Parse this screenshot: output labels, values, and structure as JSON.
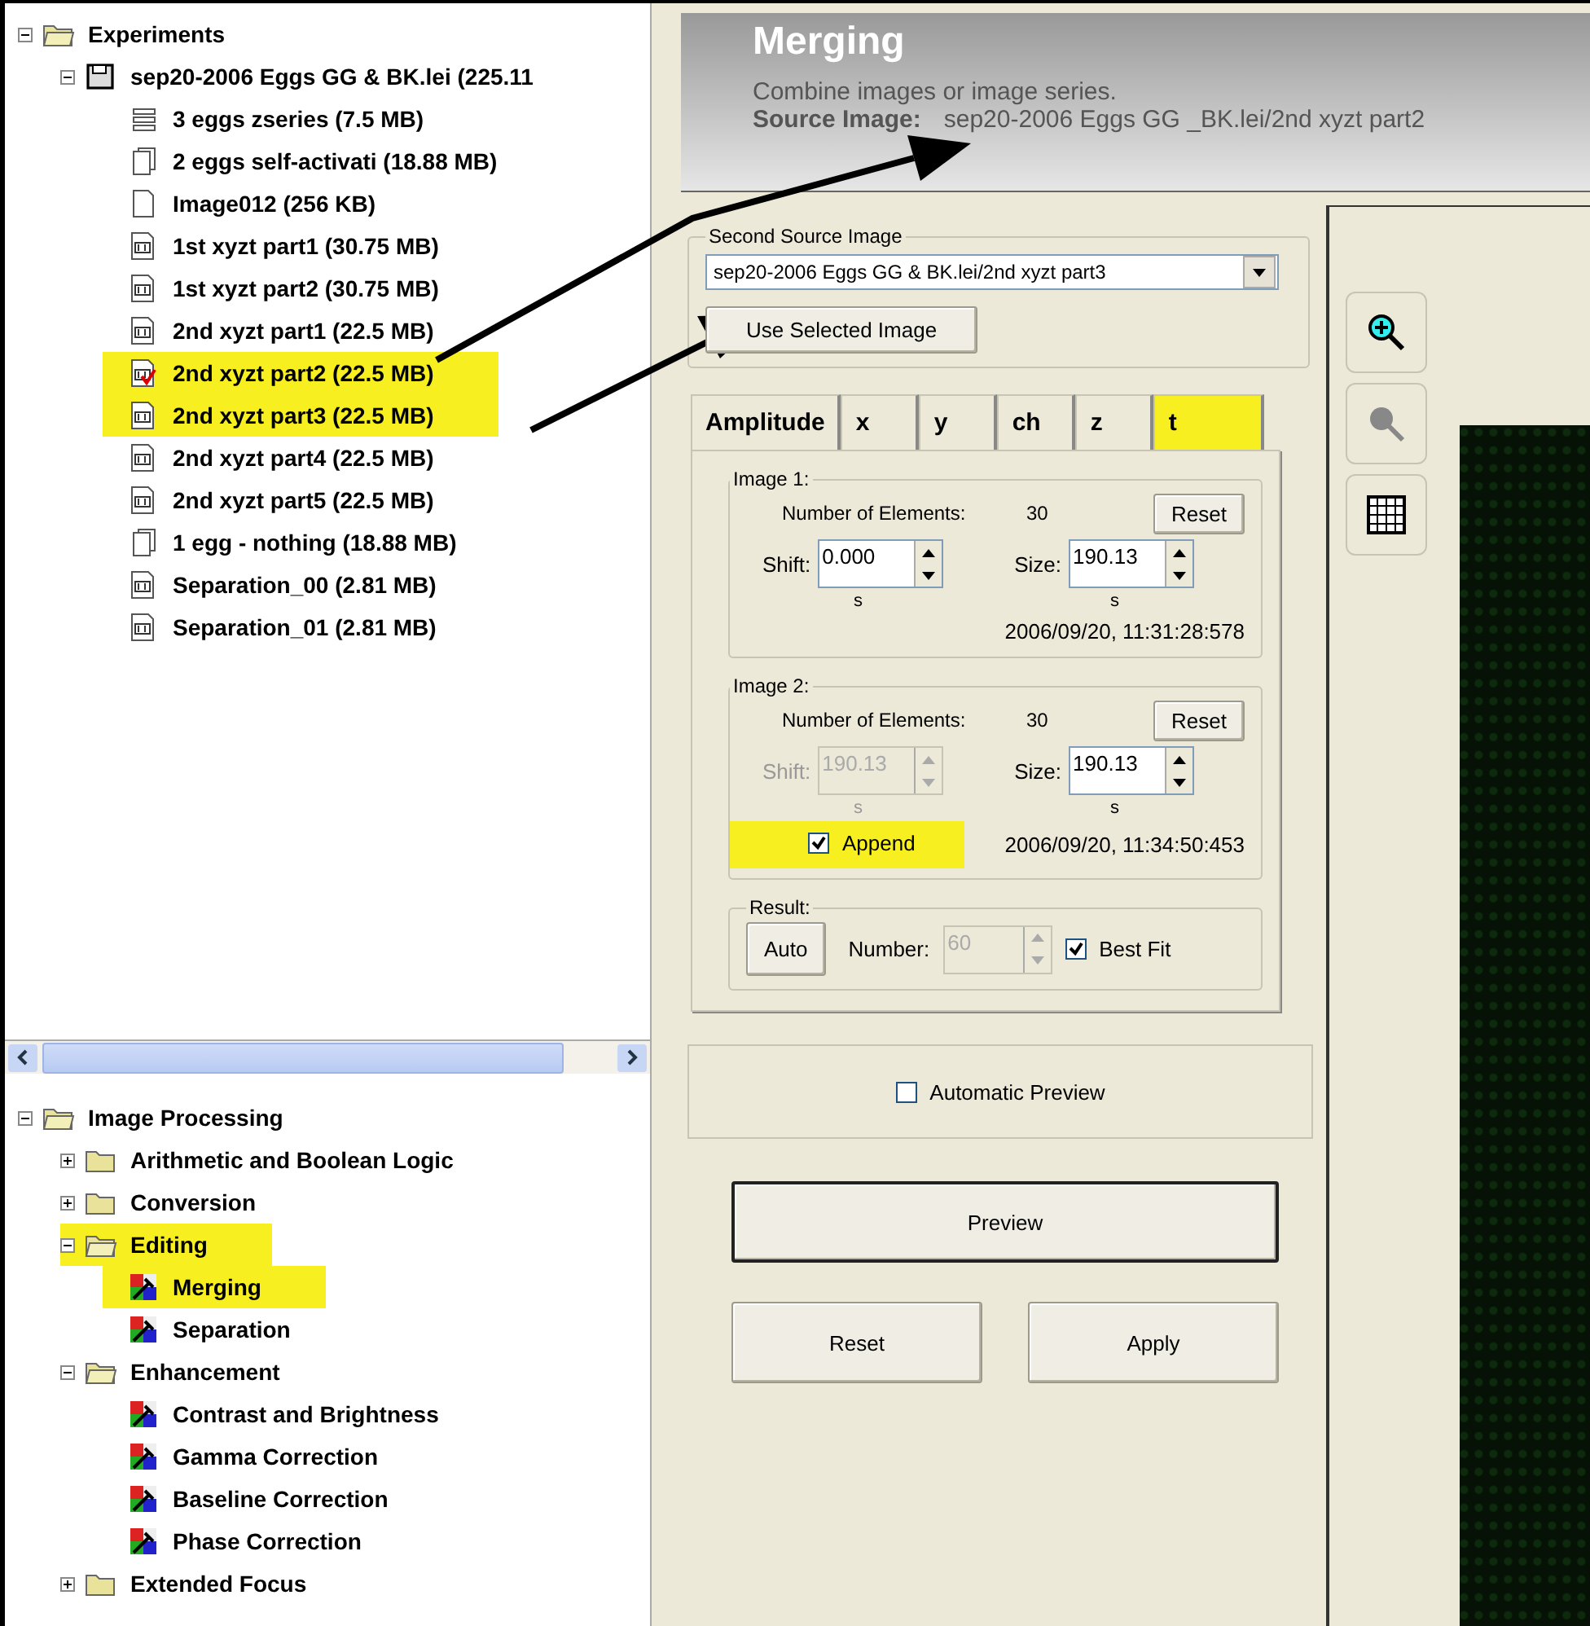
{
  "file_tree": [
    {
      "label": "Experiments",
      "kind": "folder-open",
      "expanded": true,
      "highlighted": false,
      "children": [
        {
          "label": "sep20-2006 Eggs GG & BK.lei (225.11",
          "kind": "disk",
          "expanded": true,
          "highlighted": false,
          "children": [
            {
              "label": "3 eggs zseries (7.5 MB)",
              "kind": "stack",
              "highlighted": false,
              "marked": false
            },
            {
              "label": "2 eggs self-activati (18.88 MB)",
              "kind": "pages",
              "highlighted": false,
              "marked": false
            },
            {
              "label": "Image012 (256 KB)",
              "kind": "page",
              "highlighted": false,
              "marked": false
            },
            {
              "label": "1st xyzt part1 (30.75 MB)",
              "kind": "nd",
              "highlighted": false,
              "marked": false
            },
            {
              "label": "1st xyzt part2 (30.75 MB)",
              "kind": "nd",
              "highlighted": false,
              "marked": false
            },
            {
              "label": "2nd xyzt part1 (22.5 MB)",
              "kind": "nd",
              "highlighted": false,
              "marked": false
            },
            {
              "label": "2nd xyzt part2 (22.5 MB)",
              "kind": "nd",
              "highlighted": true,
              "marked": true
            },
            {
              "label": "2nd xyzt part3 (22.5 MB)",
              "kind": "nd",
              "highlighted": true,
              "marked": false
            },
            {
              "label": "2nd xyzt part4 (22.5 MB)",
              "kind": "nd",
              "highlighted": false,
              "marked": false
            },
            {
              "label": "2nd xyzt part5 (22.5 MB)",
              "kind": "nd",
              "highlighted": false,
              "marked": false
            },
            {
              "label": "1 egg - nothing (18.88 MB)",
              "kind": "pages",
              "highlighted": false,
              "marked": false
            },
            {
              "label": "Separation_00 (2.81 MB)",
              "kind": "nd",
              "highlighted": false,
              "marked": false
            },
            {
              "label": "Separation_01 (2.81 MB)",
              "kind": "nd",
              "highlighted": false,
              "marked": false
            }
          ]
        }
      ]
    }
  ],
  "tool_tree": [
    {
      "label": "Image Processing",
      "kind": "folder-open",
      "expanded": true,
      "highlighted": false,
      "children": [
        {
          "label": "Arithmetic and Boolean Logic",
          "kind": "folder",
          "expanded": false,
          "highlighted": false
        },
        {
          "label": "Conversion",
          "kind": "folder",
          "expanded": false,
          "highlighted": false
        },
        {
          "label": "Editing",
          "kind": "folder-open",
          "expanded": true,
          "highlighted": true,
          "children": [
            {
              "label": "Merging",
              "kind": "tool",
              "highlighted": true
            },
            {
              "label": "Separation",
              "kind": "tool",
              "highlighted": false
            }
          ]
        },
        {
          "label": "Enhancement",
          "kind": "folder-open",
          "expanded": true,
          "highlighted": false,
          "children": [
            {
              "label": "Contrast and Brightness",
              "kind": "tool",
              "highlighted": false
            },
            {
              "label": "Gamma Correction",
              "kind": "tool",
              "highlighted": false
            },
            {
              "label": "Baseline Correction",
              "kind": "tool",
              "highlighted": false
            },
            {
              "label": "Phase Correction",
              "kind": "tool",
              "highlighted": false
            }
          ]
        },
        {
          "label": "Extended Focus",
          "kind": "folder",
          "expanded": false,
          "highlighted": false
        }
      ]
    }
  ],
  "header": {
    "title": "Merging",
    "description": "Combine images or image series.",
    "source_label": "Source Image:",
    "source_value": "sep20-2006 Eggs GG _BK.lei/2nd xyzt part2"
  },
  "second_source": {
    "legend": "Second Source Image",
    "value": "sep20-2006 Eggs GG & BK.lei/2nd xyzt part3",
    "button": "Use Selected Image"
  },
  "tabs": [
    {
      "label": "Amplitude",
      "selected": false
    },
    {
      "label": "x",
      "selected": false
    },
    {
      "label": "y",
      "selected": false
    },
    {
      "label": "ch",
      "selected": false
    },
    {
      "label": "z",
      "selected": false
    },
    {
      "label": "t",
      "selected": true
    }
  ],
  "images": [
    {
      "legend": "Image 1:",
      "elements_label": "Number of Elements:",
      "elements": "30",
      "reset": "Reset",
      "shift_label": "Shift:",
      "shift": "0.000",
      "shift_disabled": false,
      "shift_unit": "s",
      "size_label": "Size:",
      "size": "190.13",
      "size_unit": "s",
      "timestamp": "2006/09/20, 11:31:28:578"
    },
    {
      "legend": "Image 2:",
      "elements_label": "Number of Elements:",
      "elements": "30",
      "reset": "Reset",
      "shift_label": "Shift:",
      "shift": "190.13",
      "shift_disabled": true,
      "shift_unit": "s",
      "size_label": "Size:",
      "size": "190.13",
      "size_unit": "s",
      "timestamp": "2006/09/20, 11:34:50:453",
      "append": {
        "label": "Append",
        "checked": true,
        "highlighted": true
      }
    }
  ],
  "result": {
    "legend": "Result:",
    "auto": "Auto",
    "number_label": "Number:",
    "number": "60",
    "number_disabled": true,
    "best_fit": {
      "label": "Best Fit",
      "checked": true
    }
  },
  "automatic_preview": {
    "label": "Automatic Preview",
    "checked": false
  },
  "buttons": {
    "preview": "Preview",
    "reset": "Reset",
    "apply": "Apply"
  }
}
